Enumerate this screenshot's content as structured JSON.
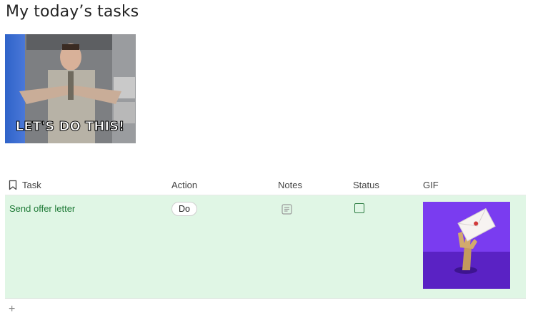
{
  "page": {
    "title": "My today’s tasks"
  },
  "hero_gif": {
    "caption": "LET'S DO THIS!",
    "icon": "gif-image"
  },
  "table": {
    "columns": [
      {
        "label": "Task",
        "icon": "bookmark-icon"
      },
      {
        "label": "Action"
      },
      {
        "label": "Notes"
      },
      {
        "label": "Status"
      },
      {
        "label": "GIF"
      }
    ],
    "rows": [
      {
        "task": "Send offer letter",
        "action": "Do",
        "notes_icon": "notes-icon",
        "status_checked": false,
        "gif_icon": "hand-holding-envelope-gif"
      }
    ],
    "add_row_label": "+"
  },
  "colors": {
    "row_background": "#e0f6e5",
    "task_text": "#1e7a36",
    "status_border": "#2e7d43",
    "gif_purple": "#7a3cf0"
  }
}
